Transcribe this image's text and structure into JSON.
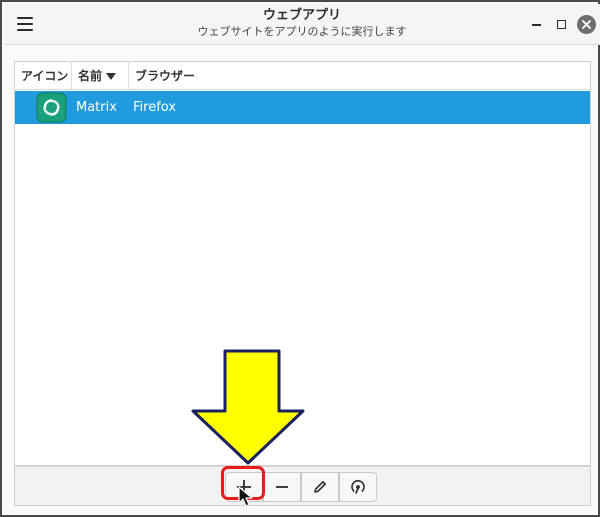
{
  "window": {
    "title": "ウェブアプリ",
    "subtitle": "ウェブサイトをアプリのように実行します"
  },
  "icons": {
    "menu": "hamburger-menu-icon",
    "minimize": "minimize-icon",
    "maximize": "maximize-icon",
    "close": "close-icon",
    "app": "matrix-element-app-icon",
    "add": "plus-icon",
    "remove": "minus-icon",
    "edit": "pencil-icon",
    "launch": "launch-icon"
  },
  "list": {
    "columns": [
      "アイコン",
      "名前",
      "ブラウザー"
    ],
    "sorted_column": "名前",
    "rows": [
      {
        "name": "Matrix",
        "browser": "Firefox",
        "selected": true
      }
    ]
  },
  "colors": {
    "selection": "#1f9bde",
    "app_icon": "#1aa07a",
    "arrow_fill": "#ffff00",
    "highlight_border": "#e81c1c"
  }
}
